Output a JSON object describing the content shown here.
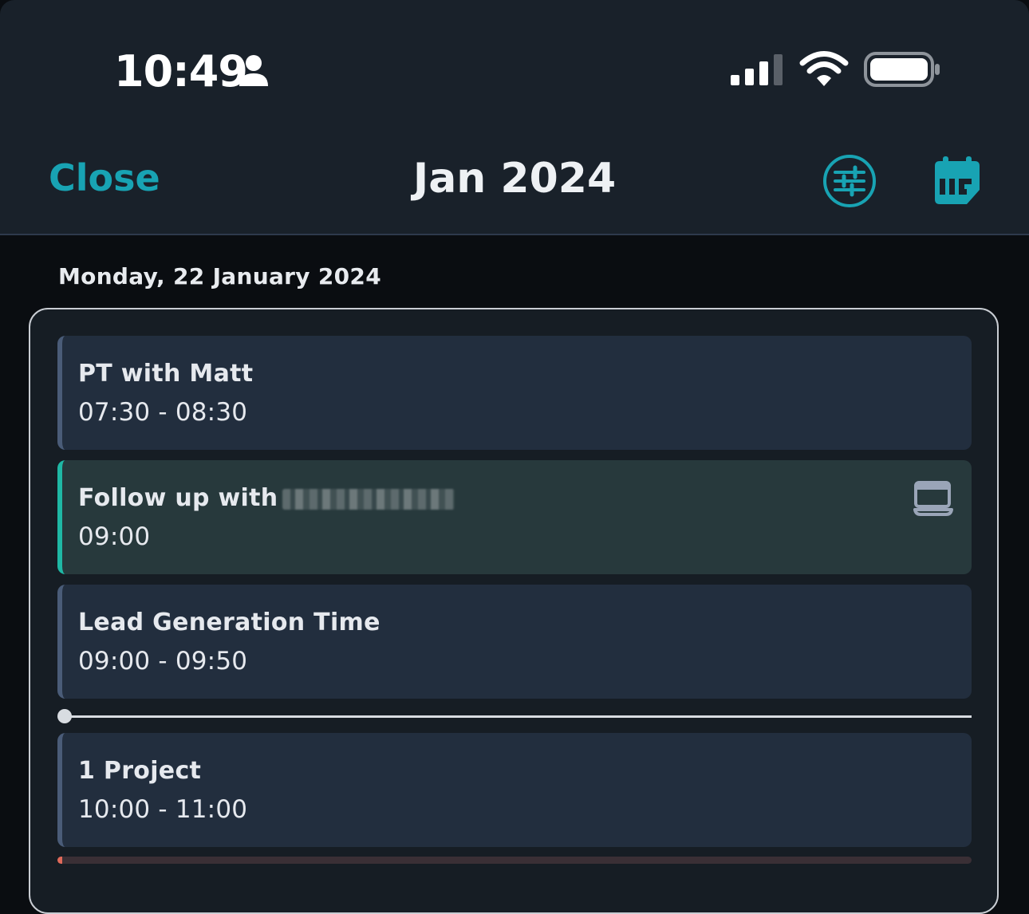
{
  "status_bar": {
    "time": "10:49",
    "icons": [
      "person-icon",
      "signal-icon",
      "wifi-icon",
      "battery-icon"
    ]
  },
  "header": {
    "close_label": "Close",
    "title": "Jan 2024",
    "icons": [
      "filter-sliders-icon",
      "calendar-icon"
    ],
    "accent_color": "#18a3b3"
  },
  "day": {
    "date_label": "Monday, 22 January 2024",
    "events": [
      {
        "title": "PT with Matt",
        "time": "07:30 - 08:30"
      },
      {
        "title": "Follow up with",
        "time": "09:00",
        "icon": "laptop-icon",
        "highlight_color": "#1fb8a5"
      },
      {
        "title": "Lead Generation Time",
        "time": "09:00 - 09:50"
      },
      {
        "title": "1 Project",
        "time": "10:00 - 11:00"
      }
    ]
  }
}
